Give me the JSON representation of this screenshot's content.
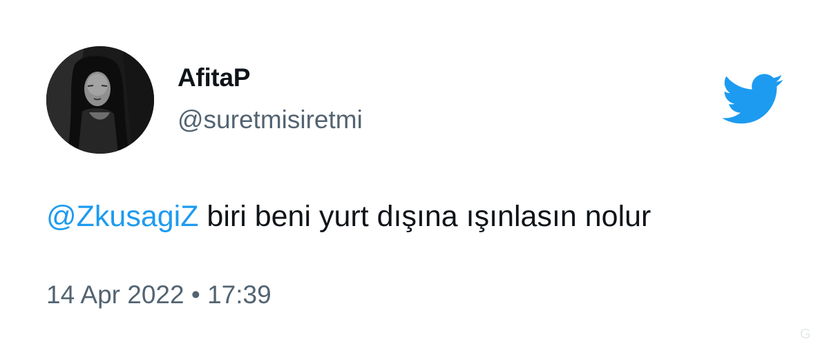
{
  "tweet": {
    "author": {
      "display_name": "AfitaP",
      "handle": "@suretmisiretmi",
      "avatar": "profile-photo"
    },
    "text": {
      "mention": "@ZkusagiZ",
      "body": " biri beni yurt dışına ışınlasın nolur"
    },
    "timestamp": {
      "date": "14 Apr 2022",
      "separator": " • ",
      "time": "17:39"
    },
    "logo": "twitter-bird-icon"
  },
  "colors": {
    "accent": "#1d9bf0",
    "text": "#0f1419",
    "secondary": "#536471",
    "background": "#ffffff"
  },
  "corner_mark": "G"
}
